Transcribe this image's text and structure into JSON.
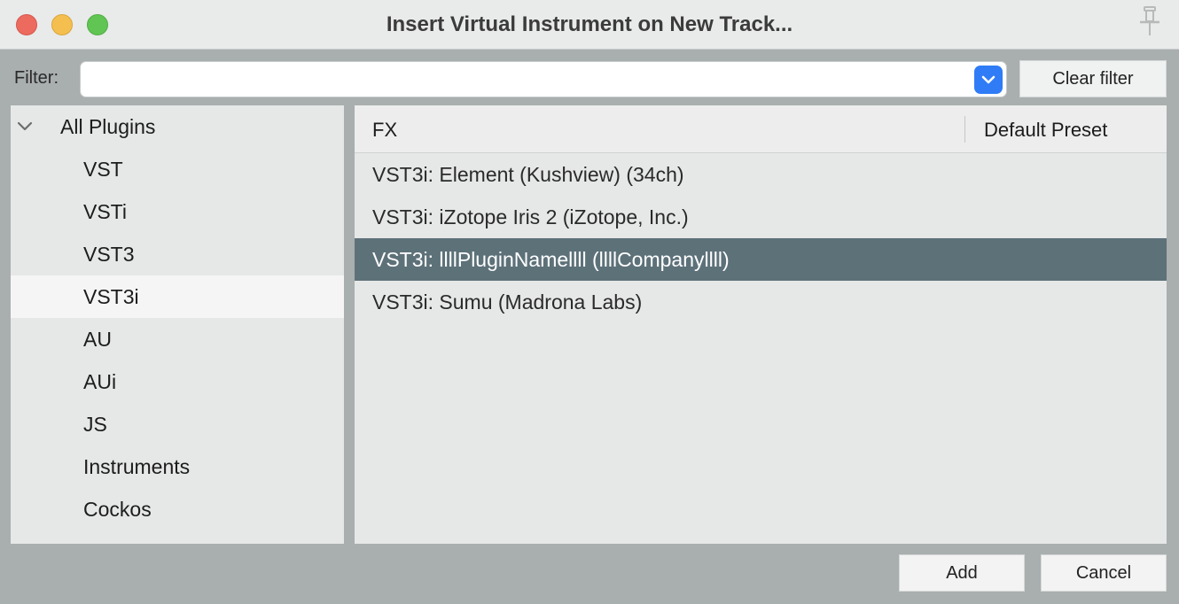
{
  "window": {
    "title": "Insert Virtual Instrument on New Track..."
  },
  "filter": {
    "label": "Filter:",
    "value": "",
    "placeholder": "",
    "clear_label": "Clear filter"
  },
  "tree": {
    "root_label": "All Plugins",
    "items": [
      {
        "label": "VST"
      },
      {
        "label": "VSTi"
      },
      {
        "label": "VST3"
      },
      {
        "label": "VST3i",
        "selected": true
      },
      {
        "label": "AU"
      },
      {
        "label": "AUi"
      },
      {
        "label": "JS"
      },
      {
        "label": "Instruments"
      },
      {
        "label": "Cockos"
      }
    ]
  },
  "list": {
    "columns": {
      "fx": "FX",
      "preset": "Default Preset"
    },
    "rows": [
      {
        "fx": "VST3i: Element (Kushview) (34ch)",
        "preset": ""
      },
      {
        "fx": "VST3i: iZotope Iris 2 (iZotope, Inc.)",
        "preset": ""
      },
      {
        "fx": "VST3i: llllPluginNamellll (llllCompanyllll)",
        "preset": "",
        "selected": true
      },
      {
        "fx": "VST3i: Sumu (Madrona Labs)",
        "preset": ""
      }
    ]
  },
  "buttons": {
    "add": "Add",
    "cancel": "Cancel"
  },
  "colors": {
    "selection_row": "#5d7179",
    "dropdown_accent": "#2f7cf6",
    "close": "#ed6a5e",
    "minimize": "#f4bf4f",
    "maximize": "#61c554"
  }
}
